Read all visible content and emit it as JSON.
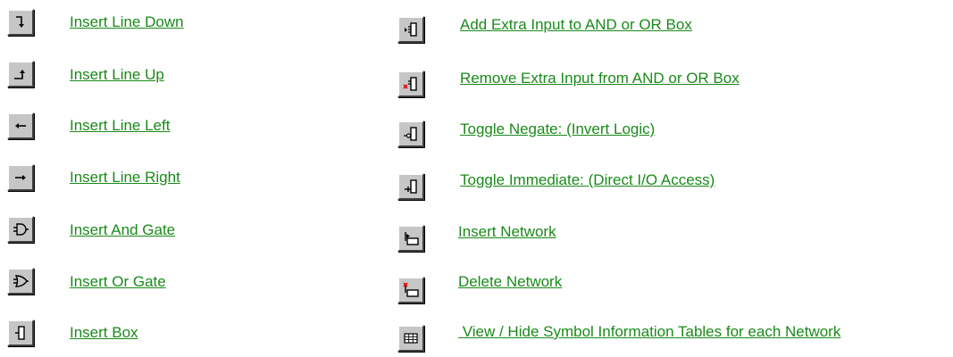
{
  "left_column": [
    {
      "label": "Insert Line Down",
      "icon": "line-down-icon"
    },
    {
      "label": "Insert Line Up",
      "icon": "line-up-icon"
    },
    {
      "label": "Insert Line Left",
      "icon": "arrow-left-icon"
    },
    {
      "label": "Insert Line Right",
      "icon": "arrow-right-icon"
    },
    {
      "label": "Insert And Gate",
      "icon": "and-gate-icon"
    },
    {
      "label": "Insert Or Gate",
      "icon": "or-gate-icon"
    },
    {
      "label": "Insert Box",
      "icon": "box-icon"
    }
  ],
  "right_column": [
    {
      "label": "Add Extra Input to AND or OR Box",
      "icon": "add-input-icon"
    },
    {
      "label": "Remove Extra Input from AND or OR Box",
      "icon": "remove-input-icon"
    },
    {
      "label": "Toggle Negate: (Invert Logic)",
      "icon": "negate-icon"
    },
    {
      "label": "Toggle Immediate: (Direct I/O Access)",
      "icon": "immediate-icon"
    },
    {
      "label": "Insert Network",
      "icon": "insert-network-icon"
    },
    {
      "label": "Delete Network",
      "icon": "delete-network-icon"
    },
    {
      "label": " View / Hide Symbol Information Tables for each Network",
      "icon": "table-icon"
    }
  ],
  "colors": {
    "link": "#1a8a1a",
    "button_face": "#c6c6c6",
    "delete_mark": "#e01010"
  }
}
